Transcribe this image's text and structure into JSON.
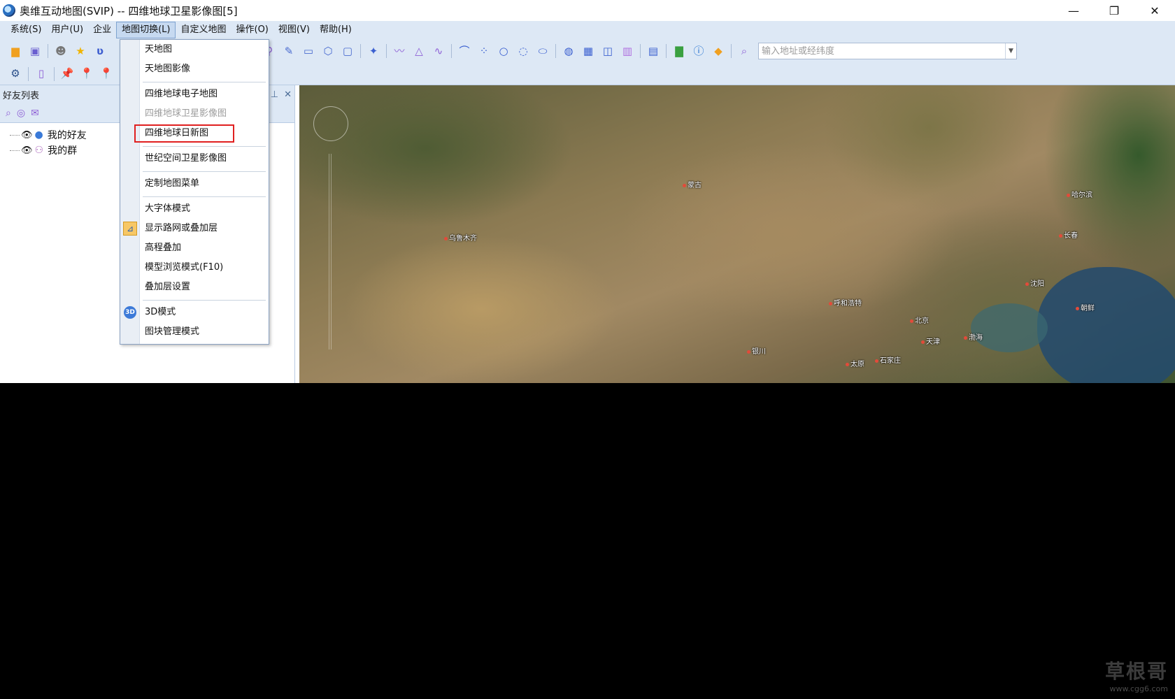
{
  "window": {
    "title": "奥维互动地图(SVIP) -- 四维地球卫星影像图[5]",
    "minimize": "—",
    "restore": "❐",
    "close": "✕"
  },
  "menubar": [
    {
      "label": "系统(S)"
    },
    {
      "label": "用户(U)"
    },
    {
      "label": "企业"
    },
    {
      "label": "地图切换(L)"
    },
    {
      "label": "自定义地图"
    },
    {
      "label": "操作(O)"
    },
    {
      "label": "视图(V)"
    },
    {
      "label": "帮助(H)"
    }
  ],
  "search": {
    "placeholder": "输入地址或经纬度"
  },
  "panel": {
    "title": "好友列表",
    "pin": "⊥",
    "close": "✕",
    "tree": [
      {
        "label": "我的好友"
      },
      {
        "label": "我的群"
      }
    ]
  },
  "dropdown": {
    "items": [
      {
        "label": "天地图"
      },
      {
        "label": "天地图影像"
      },
      {
        "label": "四维地球电子地图"
      },
      {
        "label": "四维地球卫星影像图",
        "disabled": true
      },
      {
        "label": "四维地球日新图",
        "highlighted": true
      },
      {
        "label": "世纪空间卫星影像图"
      },
      {
        "label": "定制地图菜单"
      },
      {
        "label": "大字体模式"
      },
      {
        "label": "显示路网或叠加层",
        "checked": true
      },
      {
        "label": "高程叠加"
      },
      {
        "label": "模型浏览模式(F10)"
      },
      {
        "label": "叠加层设置"
      },
      {
        "label": "3D模式",
        "icon_text": "3D"
      },
      {
        "label": "图块管理模式"
      }
    ],
    "highlight_color": "#e02020"
  },
  "map": {
    "cities": [
      "乌鲁木齐",
      "蒙古",
      "哈尔滨",
      "长春",
      "沈阳",
      "呼和浩特",
      "北京",
      "天津",
      "渤海",
      "朝鲜",
      "银川",
      "太原",
      "石家庄"
    ]
  },
  "watermark": {
    "big": "草根哥",
    "small": "www.cgg6.com"
  },
  "colors": {
    "chrome": "#dde8f5",
    "accent": "#3d7ad8"
  }
}
